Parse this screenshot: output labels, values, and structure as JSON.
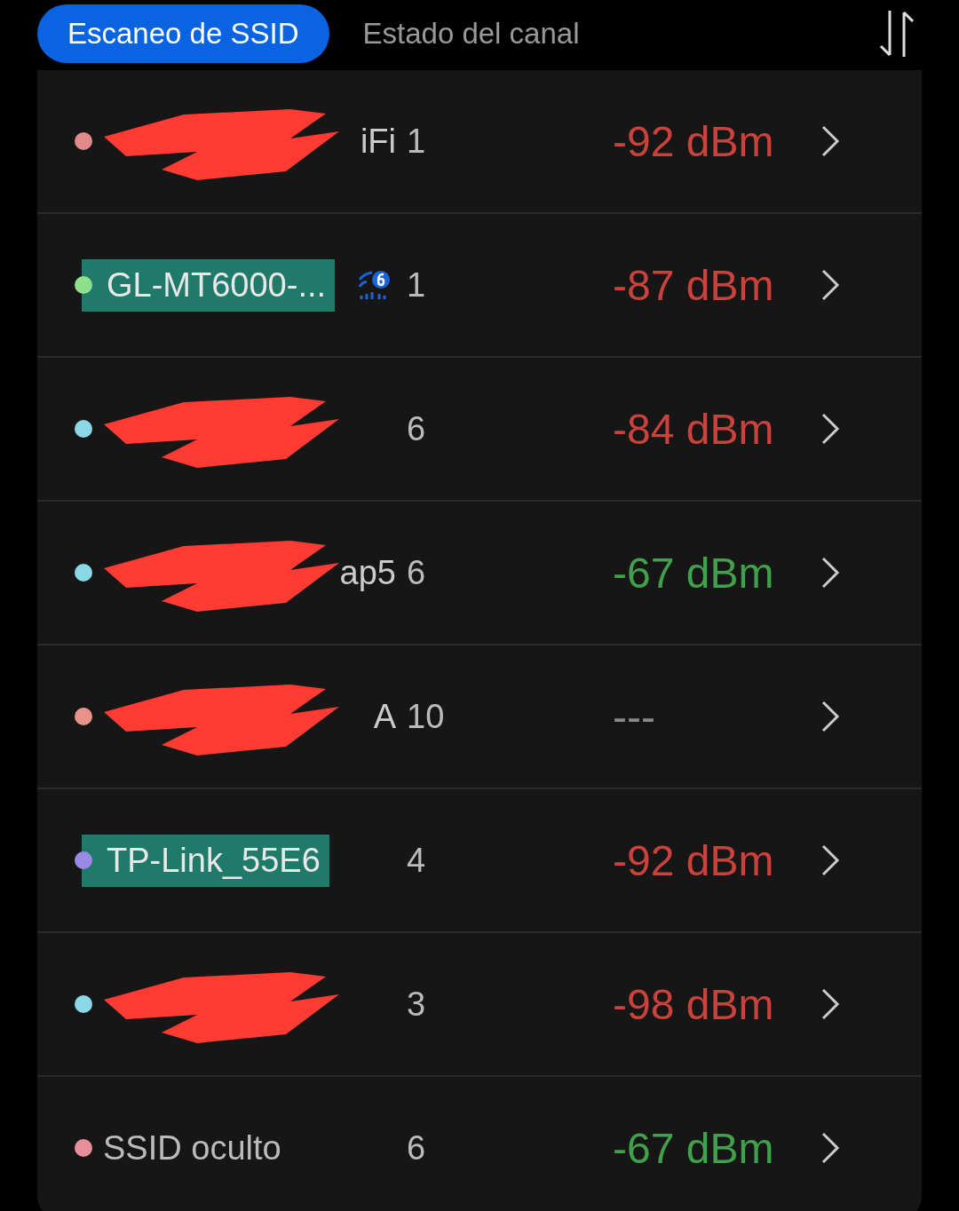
{
  "tabs": [
    {
      "label": "Escaneo de SSID",
      "selected": true
    },
    {
      "label": "Estado del canal",
      "selected": false
    }
  ],
  "networks": [
    {
      "ssid": "iFi",
      "color": "#e08a8a",
      "redacted": true,
      "highlighted": false,
      "wifi6": false,
      "channel": "1",
      "signal": {
        "text": "-92 dBm",
        "color": "#c9423c"
      }
    },
    {
      "ssid": "GL-MT6000-...",
      "color": "#8ee08a",
      "redacted": false,
      "highlighted": true,
      "wifi6": true,
      "channel": "1",
      "signal": {
        "text": "-87 dBm",
        "color": "#c9423c"
      }
    },
    {
      "color": "#8ad8e6",
      "redacted": true,
      "highlighted": false,
      "wifi6": false,
      "channel": "6",
      "signal": {
        "text": "-84 dBm",
        "color": "#c9423c"
      }
    },
    {
      "ssid": "ap5",
      "color": "#8ad8e6",
      "redacted": true,
      "highlighted": false,
      "wifi6": false,
      "channel": "6",
      "signal": {
        "text": "-67 dBm",
        "color": "#40a04c"
      }
    },
    {
      "ssid": "A",
      "color": "#e8928a",
      "redacted": true,
      "highlighted": false,
      "wifi6": false,
      "channel": "10",
      "signal": {
        "text": "---",
        "color": "#8a8a8a"
      }
    },
    {
      "ssid": "TP-Link_55E6",
      "color": "#9a8ae6",
      "redacted": false,
      "highlighted": true,
      "wifi6": false,
      "channel": "4",
      "signal": {
        "text": "-92 dBm",
        "color": "#c9423c"
      }
    },
    {
      "color": "#8ad8e6",
      "redacted": true,
      "highlighted": false,
      "wifi6": false,
      "channel": "3",
      "signal": {
        "text": "-98 dBm",
        "color": "#c9423c"
      }
    },
    {
      "ssid": "SSID oculto",
      "color": "#e8909a",
      "redacted": false,
      "highlighted": false,
      "wifi6": false,
      "channel": "6",
      "signal": {
        "text": "-67 dBm",
        "color": "#40a04c"
      }
    }
  ]
}
